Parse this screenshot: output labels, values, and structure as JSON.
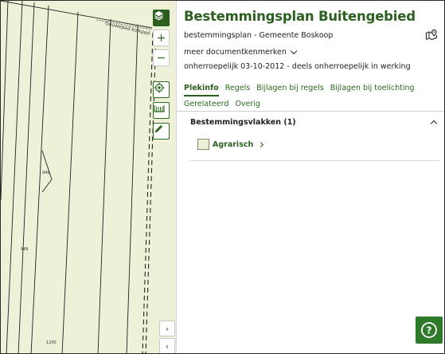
{
  "map": {
    "road_label": "Gouwepad kolkpad",
    "parcel_labels": [
      "948",
      "949",
      "1200"
    ],
    "controls": [
      {
        "name": "layers",
        "icon": "layers-icon"
      },
      {
        "name": "zoom-in",
        "icon": "plus-icon",
        "glyph": "+"
      },
      {
        "name": "zoom-out",
        "icon": "minus-icon",
        "glyph": "−"
      },
      {
        "name": "locate",
        "icon": "crosshair-icon"
      },
      {
        "name": "measure",
        "icon": "ruler-icon"
      },
      {
        "name": "draw",
        "icon": "pencil-icon"
      }
    ],
    "panel_toggle_expand": "›",
    "panel_toggle_collapse": "‹"
  },
  "panel": {
    "title": "Bestemmingsplan Buitengebied",
    "subtitle": "bestemmingsplan - Gemeente Boskoop",
    "meer_label": "meer documentkenmerken",
    "status": "onherroepelijk 03-10-2012 - deels onherroepelijk in werking",
    "tabs": [
      {
        "label": "Plekinfo",
        "active": true
      },
      {
        "label": "Regels",
        "active": false
      },
      {
        "label": "Bijlagen bij regels",
        "active": false
      },
      {
        "label": "Bijlagen bij toelichting",
        "active": false
      },
      {
        "label": "Gerelateerd",
        "active": false
      },
      {
        "label": "Overig",
        "active": false
      }
    ],
    "section": {
      "title": "Bestemmingsvlakken (1)",
      "items": [
        {
          "label": "Agrarisch",
          "swatch_color": "#eef1d8"
        }
      ]
    }
  },
  "help_button": {
    "icon": "question-icon",
    "glyph": "?"
  },
  "colors": {
    "brand_green": "#2c5f20",
    "map_fill": "#eef1d8",
    "help_green": "#2f7a2a"
  }
}
